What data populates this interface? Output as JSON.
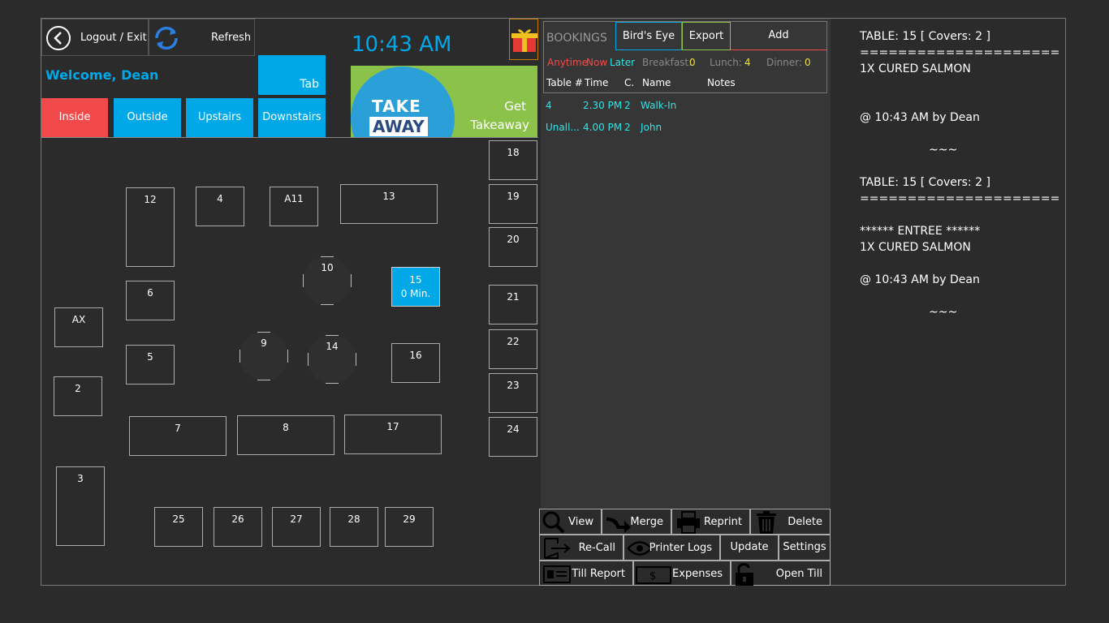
{
  "header": {
    "logout_label": "Logout / Exit",
    "refresh_label": "Refresh",
    "welcome": "Welcome, Dean",
    "tab_label": "Tab",
    "clock": "10:43 AM",
    "takeaway_line1": "Get",
    "takeaway_line2": "Takeaway",
    "takeaway_logo_top": "TAKE",
    "takeaway_logo_bottom": "AWAY"
  },
  "rooms": [
    "Inside",
    "Outside",
    "Upstairs",
    "Downstairs"
  ],
  "tables": {
    "t12": "12",
    "t4": "4",
    "tA11": "A11",
    "t13": "13",
    "t6": "6",
    "tAX": "AX",
    "t5": "5",
    "t2": "2",
    "t7": "7",
    "t8": "8",
    "t17": "17",
    "t3": "3",
    "t25": "25",
    "t26": "26",
    "t27": "27",
    "t28": "28",
    "t29": "29",
    "t10": "10",
    "t9": "9",
    "t14": "14",
    "t16": "16",
    "t15": "15",
    "t15_sub": "0 Min.",
    "t18": "18",
    "t19": "19",
    "t20": "20",
    "t21": "21",
    "t22": "22",
    "t23": "23",
    "t24": "24"
  },
  "bookings": {
    "title": "BOOKINGS",
    "birds_eye": "Bird's Eye",
    "export": "Export",
    "add": "Add",
    "filter_anytime": "Anytime",
    "filter_now": "Now",
    "filter_later": "Later",
    "breakfast_label": "Breakfast:",
    "breakfast_count": "0",
    "lunch_label": "Lunch:",
    "lunch_count": "4",
    "dinner_label": "Dinner:",
    "dinner_count": "0",
    "col_table": "Table #",
    "col_time": "Time",
    "col_covers": "C.",
    "col_name": "Name",
    "col_notes": "Notes",
    "rows": [
      {
        "table": "4",
        "time": "2.30 PM",
        "covers": "2",
        "name": "Walk-In"
      },
      {
        "table": "Unall...",
        "time": "4.00 PM",
        "covers": "2",
        "name": "John"
      }
    ]
  },
  "actions": {
    "view": "View",
    "merge": "Merge",
    "reprint": "Reprint",
    "delete": "Delete",
    "recall": "Re-Call",
    "printer_logs": "Printer Logs",
    "update": "Update",
    "settings": "Settings",
    "till_report": "Till Report",
    "expenses": "Expenses",
    "open_till": "Open Till"
  },
  "ticket": {
    "l1": "TABLE: 15 [ Covers: 2 ]",
    "l2": "=====================",
    "l3": "1X CURED SALMON",
    "l4": "@ 10:43 AM by Dean",
    "l5": "~~~",
    "l6": "TABLE: 15 [ Covers: 2 ]",
    "l7": "=====================",
    "l8": "****** ENTREE ******",
    "l9": "1X CURED SALMON",
    "l10": "@ 10:43 AM by Dean",
    "l11": "~~~"
  },
  "colors": {
    "accent": "#00a8e8",
    "inside_red": "#f24a4a",
    "takeaway_green": "#8bc34a",
    "bookings_cyan": "#2ee6e6",
    "count_yellow": "#f0e040"
  }
}
